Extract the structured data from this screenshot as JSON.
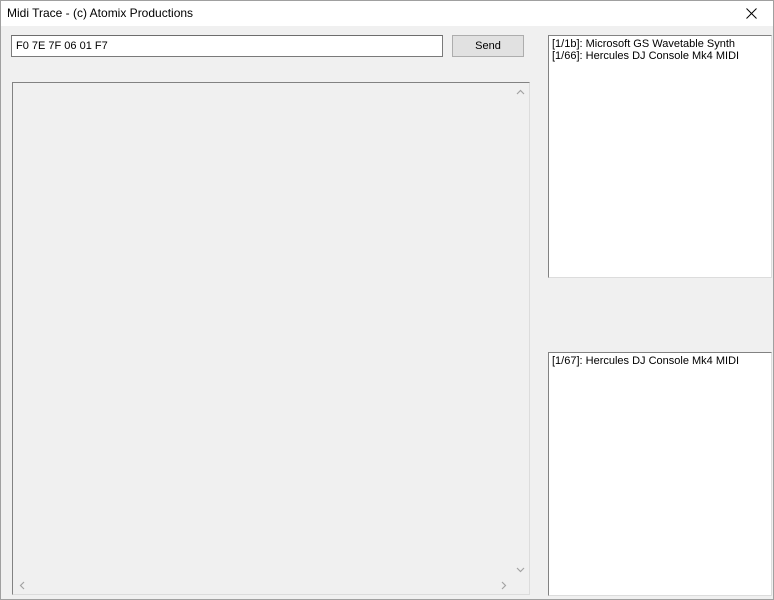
{
  "window": {
    "title": "Midi Trace - (c) Atomix Productions"
  },
  "command": {
    "value": "F0 7E 7F 06 01 F7",
    "send_label": "Send"
  },
  "input_devices": {
    "items": [
      {
        "label": "[1/1b]: Microsoft GS Wavetable Synth"
      },
      {
        "label": "[1/66]: Hercules DJ Console Mk4 MIDI"
      }
    ]
  },
  "output_devices": {
    "items": [
      {
        "label": "[1/67]: Hercules DJ Console Mk4 MIDI"
      }
    ]
  },
  "icons": {
    "close": "close-icon",
    "scroll_up": "chevron-up-icon",
    "scroll_down": "chevron-down-icon",
    "scroll_left": "chevron-left-icon",
    "scroll_right": "chevron-right-icon"
  }
}
